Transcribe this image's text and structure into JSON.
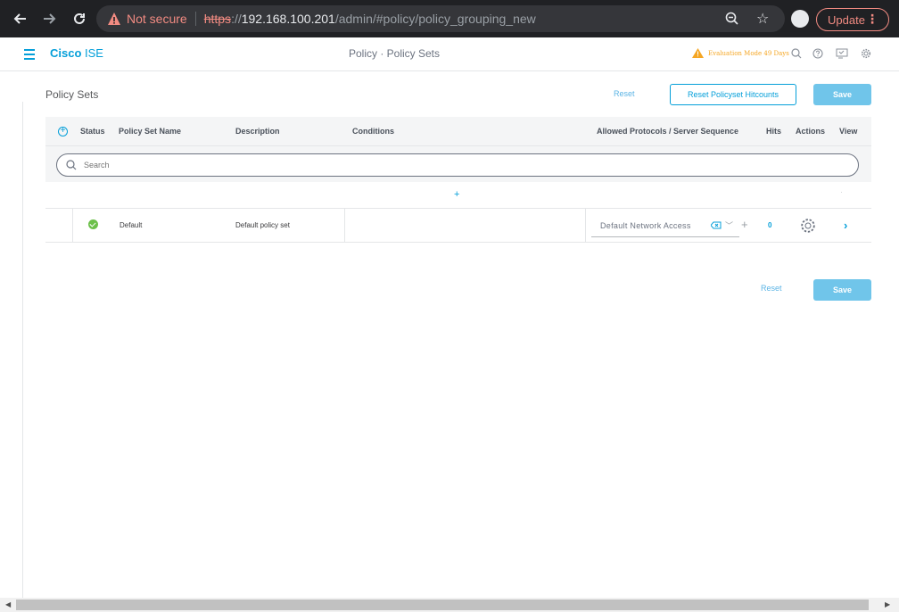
{
  "browser": {
    "not_secure": "Not secure",
    "url_scheme": "https",
    "url_sep": "://",
    "url_host": "192.168.100.201",
    "url_path": "/admin/#policy/policy_grouping_new",
    "update_label": "Update"
  },
  "header": {
    "brand_bold": "Cisco",
    "brand_light": " ISE",
    "title": "Policy · Policy Sets",
    "eval_text": "Evaluation Mode 49 Days",
    "warning_color": "#f5a623",
    "accent_color": "#049fd9"
  },
  "page": {
    "section_title": "Policy Sets",
    "reset_label": "Reset",
    "reset_hitcounts_label": "Reset Policyset Hitcounts",
    "save_label": "Save"
  },
  "table": {
    "columns": {
      "status": "Status",
      "name": "Policy Set Name",
      "description": "Description",
      "conditions": "Conditions",
      "protocols": "Allowed Protocols / Server Sequence",
      "hits": "Hits",
      "actions": "Actions",
      "view": "View"
    },
    "search_placeholder": "Search",
    "rows": [
      {
        "status": "enabled",
        "name": "Default",
        "description": "Default policy set",
        "conditions": "",
        "protocol": "Default Network Access",
        "hits": "0"
      }
    ]
  },
  "footer": {
    "reset_label": "Reset",
    "save_label": "Save"
  }
}
